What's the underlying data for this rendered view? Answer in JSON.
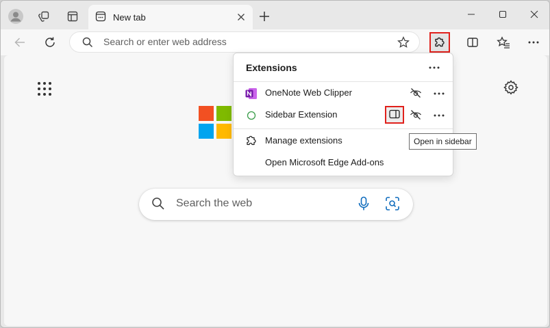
{
  "browser": {
    "tab_title": "New tab",
    "address_placeholder": "Search or enter web address"
  },
  "newtab": {
    "search_placeholder": "Search the web",
    "logo_colors": [
      "#f25022",
      "#7fba00",
      "#00a4ef",
      "#ffb900"
    ]
  },
  "extensions_flyout": {
    "title": "Extensions",
    "items": [
      {
        "name": "OneNote Web Clipper",
        "icon": "onenote-icon"
      },
      {
        "name": "Sidebar Extension",
        "icon": "circle-outline-icon"
      }
    ],
    "manage_label": "Manage extensions",
    "addons_label": "Open Microsoft Edge Add-ons"
  },
  "tooltip": {
    "text": "Open in sidebar"
  },
  "colors": {
    "highlight": "#e0201b",
    "onenote_purple": "#7719aa",
    "sidebar_ext_green": "#3a9d4a",
    "accent_blue": "#0f6cbd"
  }
}
